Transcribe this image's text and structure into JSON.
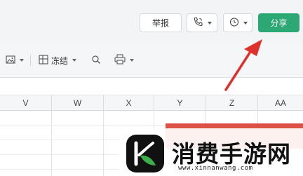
{
  "topbar": {
    "report_label": "举报",
    "share_label": "分享",
    "call_icon": "phone-call-icon",
    "history_icon": "history-clock-icon"
  },
  "toolbar": {
    "image_icon": "image-icon",
    "freeze_label": "冻结",
    "freeze_icon": "freeze-panes-icon",
    "find_icon": "search-icon",
    "print_icon": "printer-icon"
  },
  "columns": [
    "V",
    "W",
    "X",
    "Y",
    "Z",
    "AA"
  ],
  "watermark": {
    "title": "消费手游网",
    "url": "www.xinnanwang.com",
    "logo": "leaf-k-logo"
  },
  "colors": {
    "share_bg": "#2ba873",
    "arrow": "#e0302b",
    "watermark_red": "#d73228"
  }
}
